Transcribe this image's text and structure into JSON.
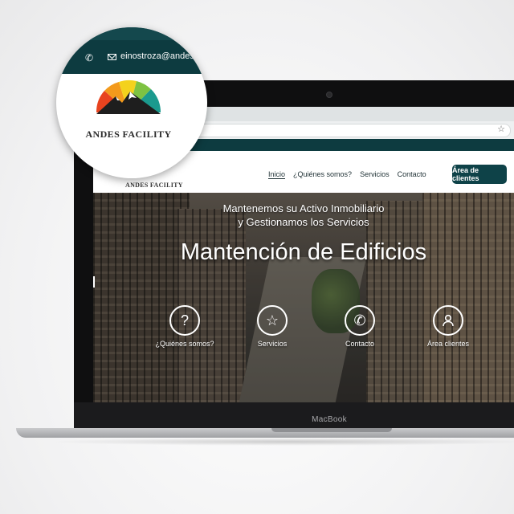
{
  "device": {
    "brand_label": "MacBook"
  },
  "magnifier": {
    "email": "einostroza@andes",
    "logo_text": "ANDES FACILITY"
  },
  "browser": {
    "bookmark_icon": "star-icon"
  },
  "site": {
    "logo_text": "ANDES FACILITY",
    "nav": [
      {
        "label": "Inicio",
        "active": true
      },
      {
        "label": "¿Quiénes somos?"
      },
      {
        "label": "Servicios"
      },
      {
        "label": "Contacto"
      }
    ],
    "cta_label": "Área de clientes",
    "hero": {
      "subtitle_line1": "Mantenemos su Activo Inmobiliario",
      "subtitle_line2": "y Gestionamos los Servicios",
      "title": "Mantención de Edificios",
      "features": [
        {
          "label": "¿Quiénes somos?",
          "icon": "question-icon"
        },
        {
          "label": "Servicios",
          "icon": "star-icon"
        },
        {
          "label": "Contacto",
          "icon": "phone-icon"
        },
        {
          "label": "Área clientes",
          "icon": "user-icon"
        }
      ]
    }
  },
  "colors": {
    "brand_dark": "#0e4248",
    "topstrip": "#0d3b40"
  }
}
